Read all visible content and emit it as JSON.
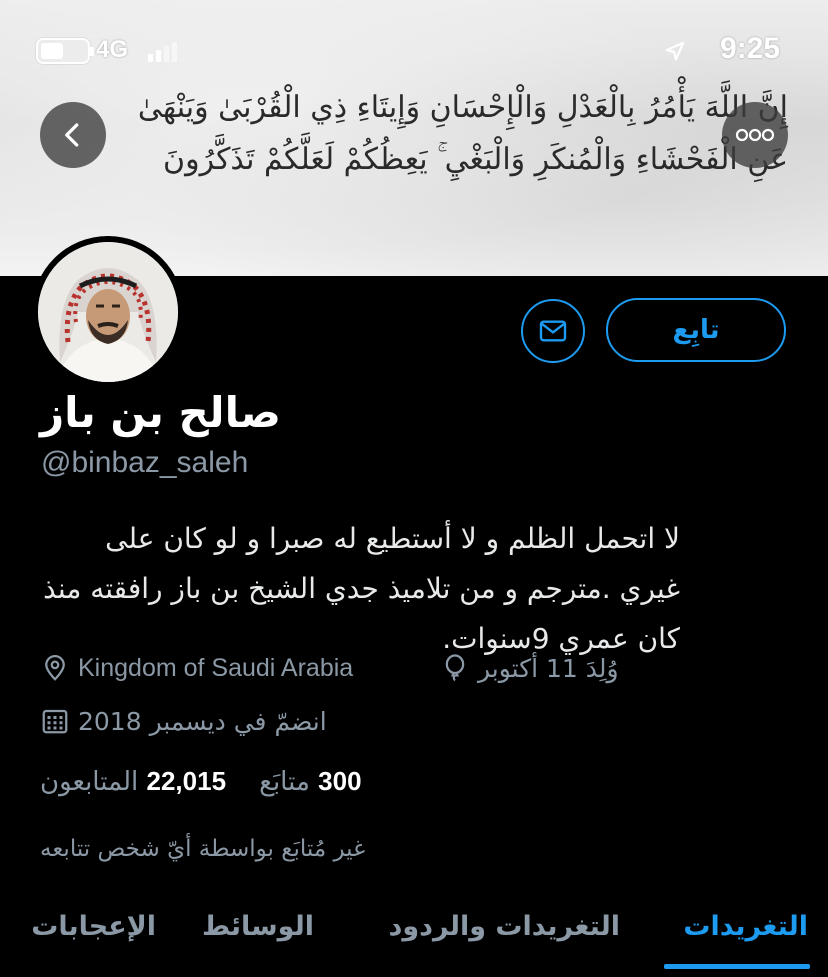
{
  "status_bar": {
    "network": "4G",
    "time": "9:25"
  },
  "banner": {
    "verse_line_1": "إِنَّ اللَّهَ يَأْمُرُ بِالْعَدْلِ وَالْإِحْسَانِ وَإِيتَاءِ ذِي الْقُرْبَىٰ وَيَنْهَىٰ",
    "verse_line_2": "عَنِ الْفَحْشَاءِ وَالْمُنكَرِ وَالْبَغْيِ ۚ يَعِظُكُمْ لَعَلَّكُمْ تَذَكَّرُونَ"
  },
  "profile": {
    "name": "صالح بن باز",
    "handle": "@binbaz_saleh",
    "bio_line_1": "لا اتحمل الظلم و لا أستطيع له صبرا و لو كان على",
    "bio_line_2": "غيري .مترجم و من تلاميذ جدي الشيخ بن باز رافقته منذ",
    "bio_line_3": "كان عمري 9سنوات.",
    "location": "Kingdom of Saudi Arabia",
    "birthday": "وُلِدَ 11 أكتوبر",
    "joined": "انضمّ في ديسمبر 2018",
    "following_count": "300",
    "following_label": "متابَع",
    "followers_count": "22,015",
    "followers_label": "المتابعون",
    "not_followed_text": "غير مُتابَع بواسطة أيّ شخص تتابعه"
  },
  "actions": {
    "follow_label": "تابِع"
  },
  "tabs": [
    {
      "label": "التغريدات",
      "active": true
    },
    {
      "label": "التغريدات والردود",
      "active": false
    },
    {
      "label": "الوسائط",
      "active": false
    },
    {
      "label": "الإعجابات",
      "active": false
    }
  ],
  "colors": {
    "accent": "#1d9bf0",
    "secondary_text": "#8b98a5",
    "background": "#000000"
  },
  "icons": [
    "battery-icon",
    "signal-icon",
    "location-arrow-icon",
    "back-chevron-icon",
    "more-dots-icon",
    "mail-icon",
    "map-pin-icon",
    "balloon-icon",
    "calendar-icon"
  ]
}
